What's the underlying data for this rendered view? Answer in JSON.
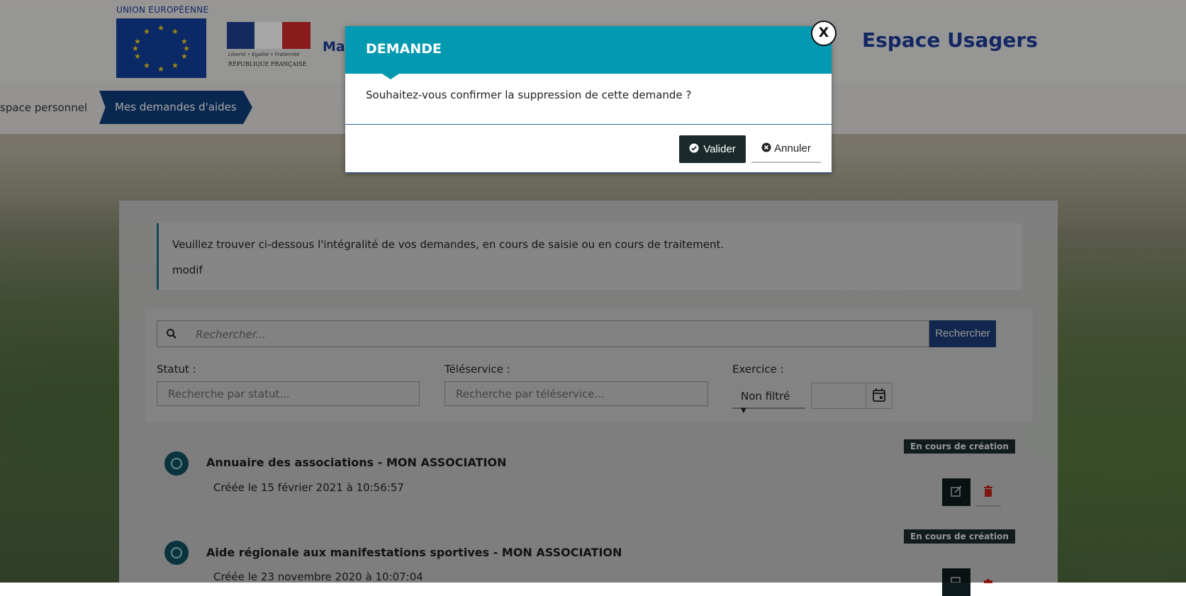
{
  "header": {
    "eu_label": "UNION EUROPÉENNE",
    "rf_motto": "Liberté • Égalité • Fraternité",
    "rf_label": "RÉPUBLIQUE FRANÇAISE",
    "partial_brand": "Ma",
    "site_title": "Espace Usagers"
  },
  "breadcrumb": {
    "items": [
      {
        "label": "space personnel"
      },
      {
        "label": "Mes demandes d'aides"
      }
    ]
  },
  "intro": {
    "line1": "Veuillez trouver ci-dessous l'intégralité de vos demandes, en cours de saisie ou en cours de traitement.",
    "line2": "modif"
  },
  "search": {
    "placeholder": "Rechercher...",
    "button_label": "Rechercher",
    "filters": {
      "statut_label": "Statut :",
      "statut_placeholder": "Recherche par statut...",
      "teleservice_label": "Téléservice :",
      "teleservice_placeholder": "Recherche par téléservice...",
      "exercice_label": "Exercice :",
      "exercice_value": "Non filtré"
    }
  },
  "requests": [
    {
      "title": "Annuaire des associations - MON ASSOCIATION",
      "created": "Créée le 15 février 2021 à 10:56:57",
      "status": "En cours de création"
    },
    {
      "title": "Aide régionale aux manifestations sportives - MON ASSOCIATION",
      "created": "Créée le 23 novembre 2020 à 10:07:04",
      "status": "En cours de création"
    }
  ],
  "modal": {
    "title": "DEMANDE",
    "message": "Souhaitez-vous confirmer la suppression de cette demande ?",
    "confirm_label": "Valider",
    "cancel_label": "Annuler",
    "close_label": "X"
  },
  "colors": {
    "modal_header": "#0399b1",
    "breadcrumb_active": "#103e7a",
    "confirm_button": "#1a2a2a",
    "brand_blue": "#1f3d99"
  }
}
